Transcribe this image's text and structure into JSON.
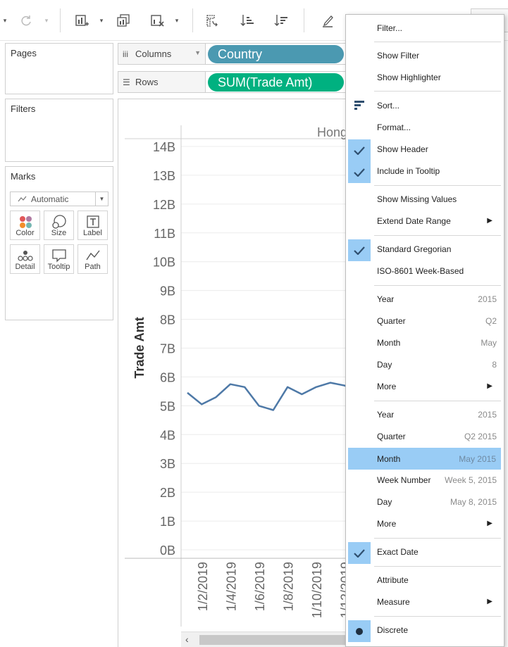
{
  "shelves": {
    "pages_title": "Pages",
    "filters_title": "Filters",
    "marks_title": "Marks",
    "columns_label": "Columns",
    "rows_label": "Rows",
    "columns_pill": "Country",
    "rows_pill": "SUM(Trade Amt)"
  },
  "marks": {
    "type": "Automatic",
    "buttons": [
      "Color",
      "Size",
      "Label",
      "Detail",
      "Tooltip",
      "Path"
    ]
  },
  "colors": {
    "pill_blue": "#4b99b1",
    "pill_green": "#00b180",
    "line": "#4e79a7",
    "menu_highlight": "#99ccf5"
  },
  "chart_data": {
    "type": "line",
    "header": "Hong",
    "ylabel": "Trade Amt",
    "ylim": [
      0,
      14
    ],
    "yticks": [
      "0B",
      "1B",
      "2B",
      "3B",
      "4B",
      "5B",
      "6B",
      "7B",
      "8B",
      "9B",
      "10B",
      "11B",
      "12B",
      "13B",
      "14B"
    ],
    "xtick_labels": [
      "1/2/2019",
      "1/4/2019",
      "1/6/2019",
      "1/8/2019",
      "1/10/2019",
      "1/12/2019"
    ],
    "series": [
      {
        "values": [
          5.45,
          5.05,
          5.3,
          5.75,
          5.65,
          5.0,
          4.85,
          5.65,
          5.4,
          5.65,
          5.8,
          5.7,
          5.4
        ]
      }
    ]
  },
  "menu": {
    "filter": "Filter...",
    "show_filter": "Show Filter",
    "show_highlighter": "Show Highlighter",
    "sort": "Sort...",
    "format": "Format...",
    "show_header": "Show Header",
    "include_tooltip": "Include in Tooltip",
    "show_missing": "Show Missing Values",
    "extend_date": "Extend Date Range",
    "std_gregorian": "Standard Gregorian",
    "iso_week": "ISO-8601 Week-Based",
    "year1": "Year",
    "year1_val": "2015",
    "quarter1": "Quarter",
    "quarter1_val": "Q2",
    "month1": "Month",
    "month1_val": "May",
    "day1": "Day",
    "day1_val": "8",
    "more1": "More",
    "year2": "Year",
    "year2_val": "2015",
    "quarter2": "Quarter",
    "quarter2_val": "Q2 2015",
    "month2": "Month",
    "month2_val": "May 2015",
    "week2": "Week Number",
    "week2_val": "Week 5, 2015",
    "day2": "Day",
    "day2_val": "May 8, 2015",
    "more2": "More",
    "exact_date": "Exact Date",
    "attribute": "Attribute",
    "measure": "Measure",
    "discrete": "Discrete"
  }
}
